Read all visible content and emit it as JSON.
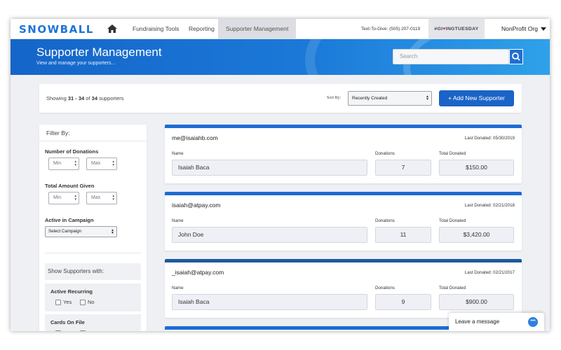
{
  "topnav": {
    "logo": "SNOWBALL",
    "links": [
      "Fundraising Tools",
      "Reporting",
      "Supporter Management"
    ],
    "text_to_give": "Text-To-Give: (505) 207-0119",
    "giving_tuesday": {
      "pre": "#GI",
      "heart": "♥",
      "post": "INGTUESDAY"
    },
    "org": "NonProfit Org"
  },
  "hero": {
    "title": "Supporter Management",
    "subtitle": "View and manage your supporters...",
    "search_placeholder": "Search"
  },
  "toolbar": {
    "showing_prefix": "Showing ",
    "range": "31 - 34",
    "of": " of ",
    "total": "34",
    "suffix": " supporters",
    "sort_label": "Sort By:",
    "sort_value": "Recently Created",
    "add_button": "+ Add New Supporter"
  },
  "filter": {
    "heading": "Filter By:",
    "num_donations_label": "Number of Donations",
    "total_given_label": "Total Amount Given",
    "min_placeholder": "Min",
    "max_placeholder": "Max",
    "campaign_label": "Active in Campaign",
    "campaign_value": "Select Campaign",
    "show_with": "Show Supporters with:",
    "active_recurring": "Active Recurring",
    "yes": "Yes",
    "no": "No",
    "cards_on_file": "Cards On File"
  },
  "card_labels": {
    "name": "Name",
    "donations": "Donations",
    "total": "Total Donated"
  },
  "supporters": [
    {
      "email": "me@isaiahb.com",
      "last_donated": "Last Donated: 05/30/2019",
      "name": "Isaiah Baca",
      "donations": "7",
      "total": "$150.00"
    },
    {
      "email": "isaiah@atpay.com",
      "last_donated": "Last Donated: 02/21/2018",
      "name": "John Doe",
      "donations": "11",
      "total": "$3,420.00"
    },
    {
      "email": "_isaiah@atpay.com",
      "last_donated": "Last Donated: 02/21/2017",
      "name": "Isaiah Baca",
      "donations": "9",
      "total": "$900.00"
    }
  ],
  "chat": {
    "label": "Leave a message"
  },
  "colors": {
    "brand": "#1f74d6",
    "accent_button": "#1b63c6",
    "heart": "#d8342c"
  }
}
